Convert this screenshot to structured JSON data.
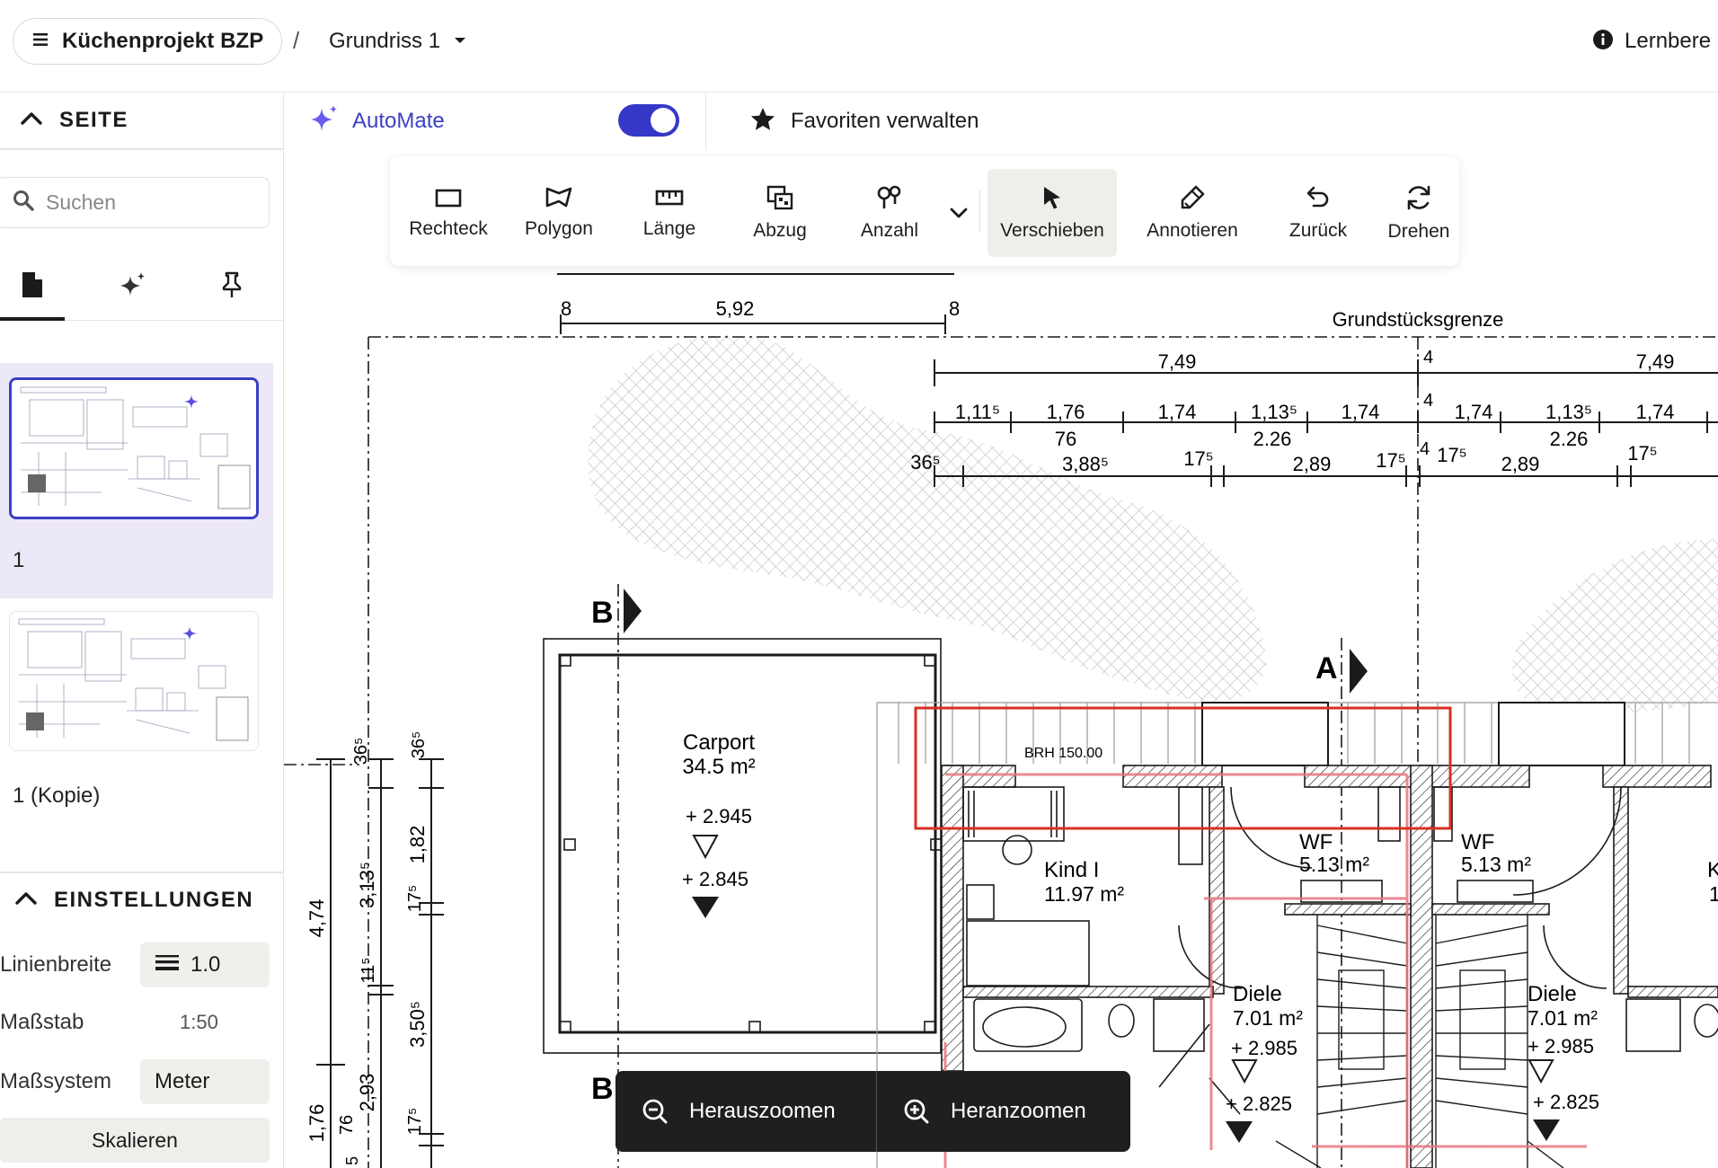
{
  "header": {
    "project_title": "Küchenprojekt BZP",
    "separator": "/",
    "plan_name": "Grundriss 1",
    "learn_label": "Lernbere"
  },
  "sidebar": {
    "section_label": "SEITE",
    "search_placeholder": "Suchen",
    "tabs": [
      "pages",
      "ai",
      "pinned"
    ],
    "pages": [
      {
        "label": "1",
        "selected": true
      },
      {
        "label": "1 (Kopie)",
        "selected": false
      }
    ],
    "settings": {
      "section_label": "EINSTELLUNGEN",
      "line_width_label": "Linienbreite",
      "line_width_value": "1.0",
      "scale_label": "Maßstab",
      "scale_value": "1:50",
      "measure_system_label": "Maßsystem",
      "measure_system_value": "Meter",
      "scale_button": "Skalieren"
    }
  },
  "subheader": {
    "automate_label": "AutoMate",
    "automate_enabled": true,
    "favorites_label": "Favoriten verwalten"
  },
  "toolbar": {
    "tools": [
      {
        "label": "Rechteck",
        "icon": "rectangle-icon"
      },
      {
        "label": "Polygon",
        "icon": "polygon-icon"
      },
      {
        "label": "Länge",
        "icon": "ruler-icon"
      },
      {
        "label": "Abzug",
        "icon": "deduct-icon"
      },
      {
        "label": "Anzahl",
        "icon": "count-icon"
      },
      {
        "label": "Verschieben",
        "icon": "cursor-icon",
        "active": true
      },
      {
        "label": "Annotieren",
        "icon": "annotate-icon"
      },
      {
        "label": "Zurück",
        "icon": "undo-icon"
      },
      {
        "label": "Drehen",
        "icon": "rotate-icon"
      }
    ]
  },
  "zoom": {
    "out_label": "Herauszoomen",
    "in_label": "Heranzoomen"
  },
  "drawing": {
    "property_line": "Grundstücksgrenze",
    "dims_top": [
      "8",
      "5,92",
      "8"
    ],
    "dims_row1": [
      "7,49",
      "4",
      "7,49"
    ],
    "dims_row2": [
      "1,11⁵",
      "1,76",
      "1,74",
      "1,13⁵",
      "1,74",
      "4",
      "1,74",
      "1,13⁵",
      "1,74"
    ],
    "dims_row2b": [
      "76",
      "2.26",
      "2.26"
    ],
    "dims_row3": [
      "36⁵",
      "3,88⁵",
      "17⁵",
      "2,89",
      "17⁵",
      "4",
      "17⁵",
      "2,89",
      "17⁵"
    ],
    "section_b": "B",
    "section_a": "A",
    "carport_name": "Carport",
    "carport_area": "34.5 m²",
    "carport_level1": "+ 2.945",
    "carport_level2": "+ 2.845",
    "brh": "BRH 150.00",
    "kind_name": "Kind I",
    "kind_area": "11.97 m²",
    "wf1_name": "WF",
    "wf1_area": "5.13 m²",
    "wf2_name": "WF",
    "wf2_area": "5.13 m²",
    "diele1_name": "Diele",
    "diele1_area": "7.01 m²",
    "diele1_level": "+ 2.985",
    "diele1_level2": "+ 2.825",
    "diele2_name": "Diele",
    "diele2_area": "7.01 m²",
    "diele2_level": "+ 2.985",
    "diele2_level2": "+ 2.825",
    "right_cut_letter": "K",
    "right_cut_digit": "1",
    "vdims_left": [
      "4,74",
      "1,76",
      "36⁵",
      "3,13⁵",
      "11⁵",
      "2,93",
      "76",
      "5"
    ],
    "vdims_right": [
      "36⁵",
      "1,82",
      "17⁵",
      "3,50⁵",
      "17⁵"
    ]
  },
  "colors": {
    "accent": "#3538c6",
    "selection_red": "#d93025",
    "annotation_pink": "#e8757f",
    "hatch": "#c9c9c9"
  }
}
